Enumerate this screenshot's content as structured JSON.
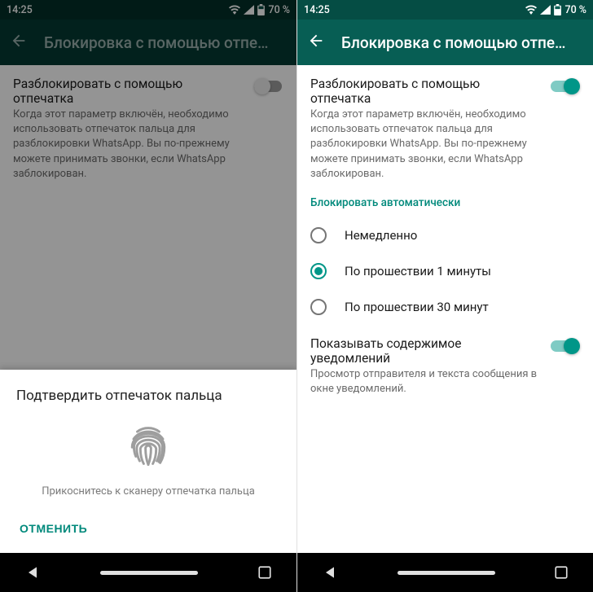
{
  "status": {
    "time": "14:25",
    "battery": "70 %"
  },
  "appbar": {
    "title": "Блокировка с помощью отпе…"
  },
  "unlock": {
    "title": "Разблокировать с помощью отпечатка",
    "desc": "Когда этот параметр включён, необходимо использовать отпечаток пальца для разблокировки WhatsApp. Вы по-прежнему можете принимать звонки, если WhatsApp заблокирован."
  },
  "autolock": {
    "header": "Блокировать автоматически",
    "options": [
      "Немедленно",
      "По прошествии 1 минуты",
      "По прошествии 30 минут"
    ],
    "selected": 1
  },
  "notif": {
    "title": "Показывать содержимое уведомлений",
    "desc": "Просмотр отправителя и текста сообщения в окне уведомлений."
  },
  "sheet": {
    "title": "Подтвердить отпечаток пальца",
    "message": "Прикоснитесь к сканеру отпечатка пальца",
    "cancel": "ОТМЕНИТЬ"
  }
}
